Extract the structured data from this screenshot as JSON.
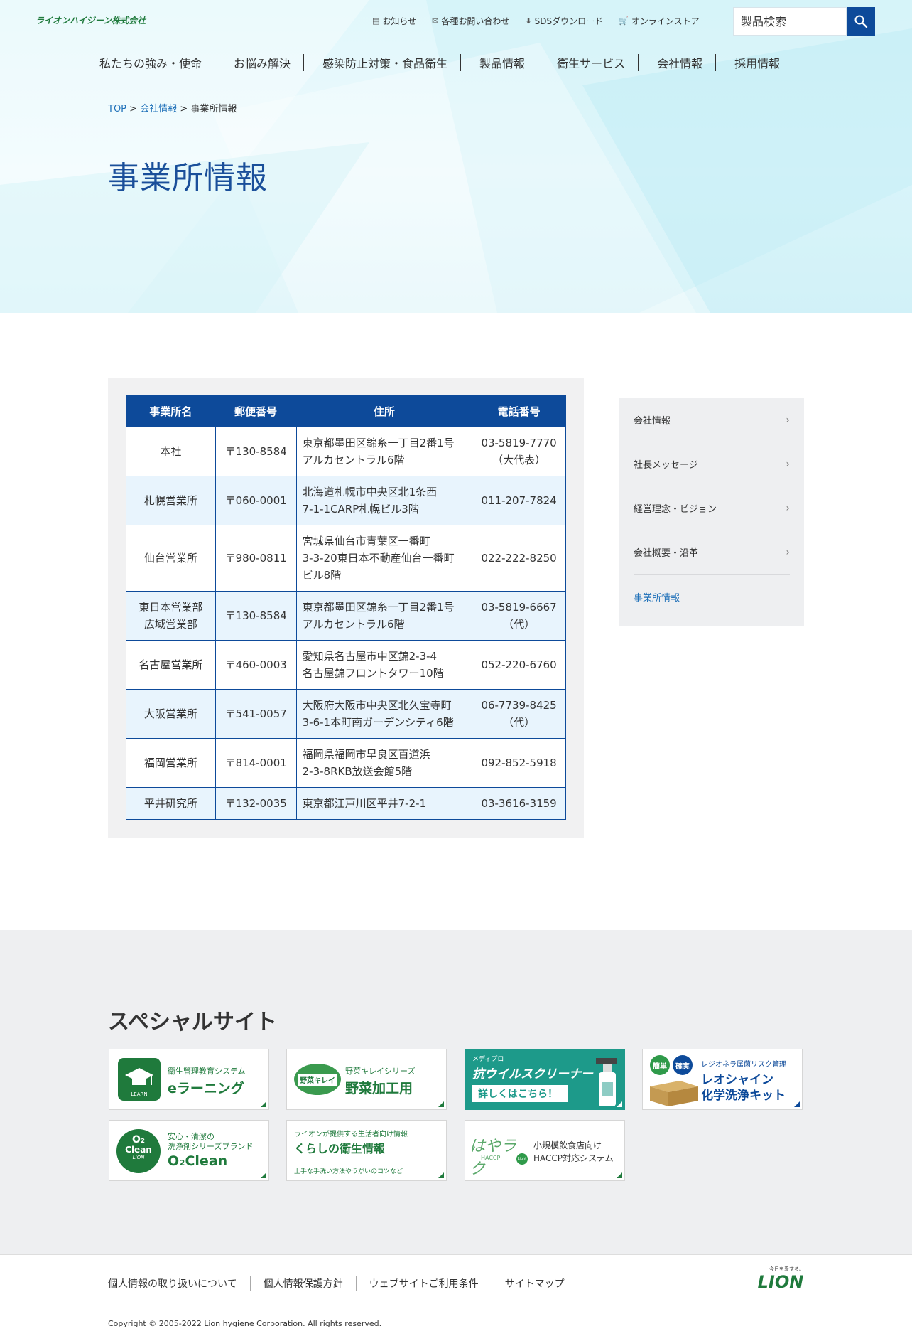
{
  "header": {
    "logo_text": "ライオンハイジーン株式会社",
    "top_links": [
      {
        "icon": "news-icon",
        "label": "お知らせ"
      },
      {
        "icon": "mail-icon",
        "label": "各種お問い合わせ"
      },
      {
        "icon": "download-icon",
        "label": "SDSダウンロード"
      },
      {
        "icon": "cart-icon",
        "label": "オンラインストア"
      }
    ],
    "search": {
      "placeholder": "製品検索"
    },
    "main_nav": [
      "私たちの強み・使命",
      "お悩み解決",
      "感染防止対策・食品衛生",
      "製品情報",
      "衛生サービス",
      "会社情報",
      "採用情報"
    ]
  },
  "breadcrumb": {
    "top": "TOP",
    "sep": ">",
    "parent": "会社情報",
    "current": "事業所情報"
  },
  "page_title": "事業所情報",
  "office_table": {
    "headers": [
      "事業所名",
      "郵便番号",
      "住所",
      "電話番号"
    ],
    "rows": [
      {
        "name": "本社",
        "zip": "〒130-8584",
        "addr1": "東京都墨田区錦糸一丁目2番1号",
        "addr2": "アルカセントラル6階",
        "addr3": "",
        "tel": "03-5819-7770",
        "tel_note": "（大代表）"
      },
      {
        "name": "札幌営業所",
        "name2": "",
        "zip": "〒060-0001",
        "addr1": "北海道札幌市中央区北1条西",
        "addr2": "7-1-1CARP札幌ビル3階",
        "addr3": "",
        "tel": "011-207-7824",
        "tel_note": ""
      },
      {
        "name": "仙台営業所",
        "name2": "",
        "zip": "〒980-0811",
        "addr1": "宮城県仙台市青葉区一番町",
        "addr2": "3-3-20東日本不動産仙台一番町",
        "addr3": "ビル8階",
        "tel": "022-222-8250",
        "tel_note": ""
      },
      {
        "name": "東日本営業部",
        "name2": "広域営業部",
        "zip": "〒130-8584",
        "addr1": "東京都墨田区錦糸一丁目2番1号",
        "addr2": "アルカセントラル6階",
        "addr3": "",
        "tel": "03-5819-6667",
        "tel_note": "（代）"
      },
      {
        "name": "名古屋営業所",
        "name2": "",
        "zip": "〒460-0003",
        "addr1": "愛知県名古屋市中区錦2-3-4",
        "addr2": "名古屋錦フロントタワー10階",
        "addr3": "",
        "tel": "052-220-6760",
        "tel_note": ""
      },
      {
        "name": "大阪営業所",
        "name2": "",
        "zip": "〒541-0057",
        "addr1": "大阪府大阪市中央区北久宝寺町",
        "addr2": "3-6-1本町南ガーデンシティ6階",
        "addr3": "",
        "tel": "06-7739-8425",
        "tel_note": "（代）"
      },
      {
        "name": "福岡営業所",
        "name2": "",
        "zip": "〒814-0001",
        "addr1": "福岡県福岡市早良区百道浜",
        "addr2": "2-3-8RKB放送会館5階",
        "addr3": "",
        "tel": "092-852-5918",
        "tel_note": ""
      },
      {
        "name": "平井研究所",
        "name2": "",
        "zip": "〒132-0035",
        "addr1": "東京都江戸川区平井7-2-1",
        "addr2": "",
        "addr3": "",
        "tel": "03-3616-3159",
        "tel_note": ""
      }
    ]
  },
  "side_nav": [
    {
      "label": "会社情報",
      "active": false
    },
    {
      "label": "社長メッセージ",
      "active": false
    },
    {
      "label": "経営理念・ビジョン",
      "active": false
    },
    {
      "label": "会社概要・沿革",
      "active": false
    },
    {
      "label": "事業所情報",
      "active": true
    }
  ],
  "special_sites": {
    "title": "スペシャルサイト",
    "banners": {
      "elearning": {
        "sub": "衛生管理教育システム",
        "main": "eラーニング",
        "badge": "LEARN"
      },
      "yasai": {
        "sub": "野菜キレイシリーズ",
        "main": "野菜加工用",
        "badge": "野菜キレイ"
      },
      "antivirus": {
        "brand": "メディプロ",
        "main": "抗ウイルスクリーナー",
        "cta": "詳しくはこちら！"
      },
      "legionella": {
        "tag1": "簡単",
        "tag2": "確実",
        "sub": "レジオネラ属菌リスク管理",
        "main1": "レオシャイン",
        "main2": "化学洗浄キット"
      },
      "o2clean": {
        "sub1": "安心・清潔の",
        "sub2": "洗浄剤シリーズブランド",
        "main": "O₂Clean",
        "badge1": "O₂",
        "badge2": "Clean",
        "badge3": "LION"
      },
      "kurashi": {
        "sub": "ライオンが提供する生活者向け情報",
        "main": "くらしの衛生情報",
        "note": "上手な手洗い方法やうがいのコツなど"
      },
      "hayaraku": {
        "logo": "はやラク",
        "logo_sub": "HACCP",
        "logo_badge": "Light",
        "sub1": "小規模飲食店向け",
        "sub2": "HACCP対応システム"
      }
    }
  },
  "footer": {
    "links": [
      "個人情報の取り扱いについて",
      "個人情報保護方針",
      "ウェブサイトご利用条件",
      "サイトマップ"
    ],
    "copyright": "Copyright © 2005-2022 Lion hygiene Corporation. All rights reserved.",
    "lion_tagline": "今日を愛する。",
    "lion_word": "LION"
  },
  "colors": {
    "brand_blue": "#0d4a9a",
    "brand_green": "#1f7a3c",
    "link_blue": "#1d6fb8",
    "table_alt": "#e8f4fd"
  }
}
